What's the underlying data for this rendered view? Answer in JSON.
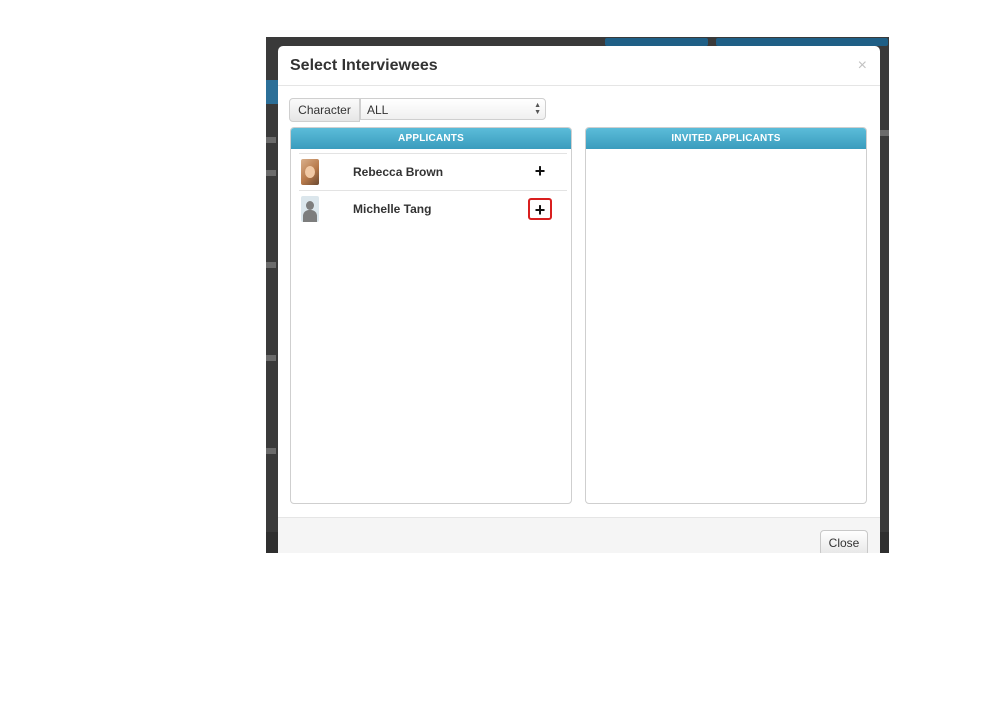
{
  "modal": {
    "title": "Select Interviewees",
    "close_icon": "×",
    "filter": {
      "label": "Character",
      "selected": "ALL"
    },
    "applicants_header": "APPLICANTS",
    "invited_header": "INVITED APPLICANTS",
    "applicants": [
      {
        "name": "Rebecca Brown",
        "avatar": "photo",
        "action": "+"
      },
      {
        "name": "Michelle Tang",
        "avatar": "default-silhouette",
        "action": "+"
      }
    ],
    "invited": [],
    "footer": {
      "close_label": "Close"
    }
  },
  "colors": {
    "panel_header": "#4aaed0",
    "highlight": "#d91f1f",
    "backdrop": "#3a3a3a"
  }
}
